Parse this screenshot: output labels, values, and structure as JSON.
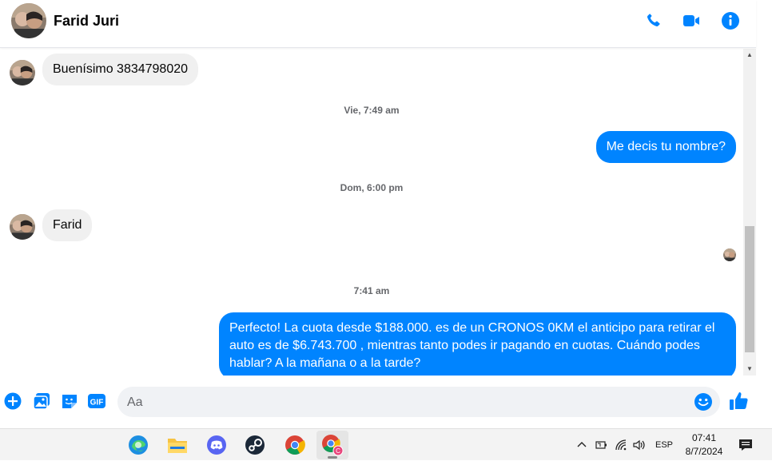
{
  "header": {
    "contact_name": "Farid Juri"
  },
  "messages": [
    {
      "type": "in",
      "text": "Buenísimo 3834798020"
    },
    {
      "type": "timestamp",
      "text": "Vie, 7:49 am"
    },
    {
      "type": "out",
      "text": "Me decis tu nombre?"
    },
    {
      "type": "timestamp",
      "text": "Dom, 6:00 pm"
    },
    {
      "type": "in",
      "text": "Farid"
    },
    {
      "type": "timestamp",
      "text": "7:41 am"
    },
    {
      "type": "out",
      "text": "Perfecto! La cuota desde $188.000. es de un CRONOS 0KM el anticipo para retirar el auto es de $6.743.700 , mientras tanto podes ir pagando en cuotas. Cuándo podes hablar? A la mañana o a la tarde?"
    }
  ],
  "composer": {
    "placeholder": "Aa"
  },
  "taskbar": {
    "apps": [
      "edge-icon",
      "file-explorer-icon",
      "discord-icon",
      "steam-icon",
      "chrome-icon",
      "chrome-profile-icon"
    ],
    "language": "ESP",
    "time": "07:41",
    "date": "8/7/2024"
  },
  "colors": {
    "accent": "#0084ff",
    "incoming_bubble": "#f0f0f0"
  }
}
